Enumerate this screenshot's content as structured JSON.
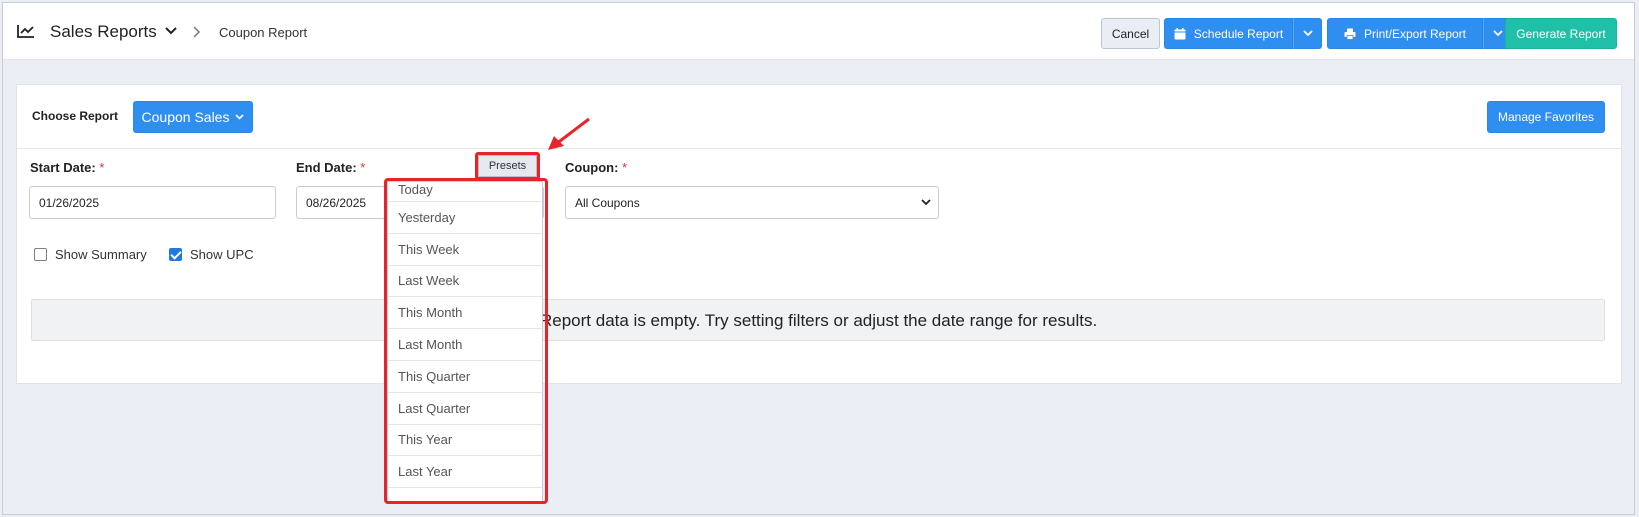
{
  "header": {
    "title": "Sales Reports",
    "breadcrumb": "Coupon Report",
    "cancel_label": "Cancel",
    "schedule_label": "Schedule Report",
    "print_label": "Print/Export Report",
    "generate_label": "Generate Report"
  },
  "report": {
    "choose_label": "Choose Report",
    "selected_report": "Coupon Sales",
    "manage_favorites_label": "Manage Favorites"
  },
  "filters": {
    "start_date_label": "Start Date:",
    "start_date_value": "01/26/2025",
    "end_date_label": "End Date:",
    "end_date_value": "08/26/2025",
    "presets_label": "Presets",
    "coupon_label": "Coupon:",
    "coupon_value": "All Coupons",
    "required_mark": "*",
    "show_summary_label": "Show Summary",
    "show_summary_checked": false,
    "show_upc_label": "Show UPC",
    "show_upc_checked": true
  },
  "presets_menu": {
    "items": [
      "Today",
      "Yesterday",
      "This Week",
      "Last Week",
      "This Month",
      "Last Month",
      "This Quarter",
      "Last Quarter",
      "This Year",
      "Last Year"
    ]
  },
  "empty_message": "Report data is empty. Try setting filters or adjust the date range for results.",
  "colors": {
    "primary": "#2e8ff0",
    "teal": "#1fc0a7",
    "highlight": "#e8232b"
  }
}
